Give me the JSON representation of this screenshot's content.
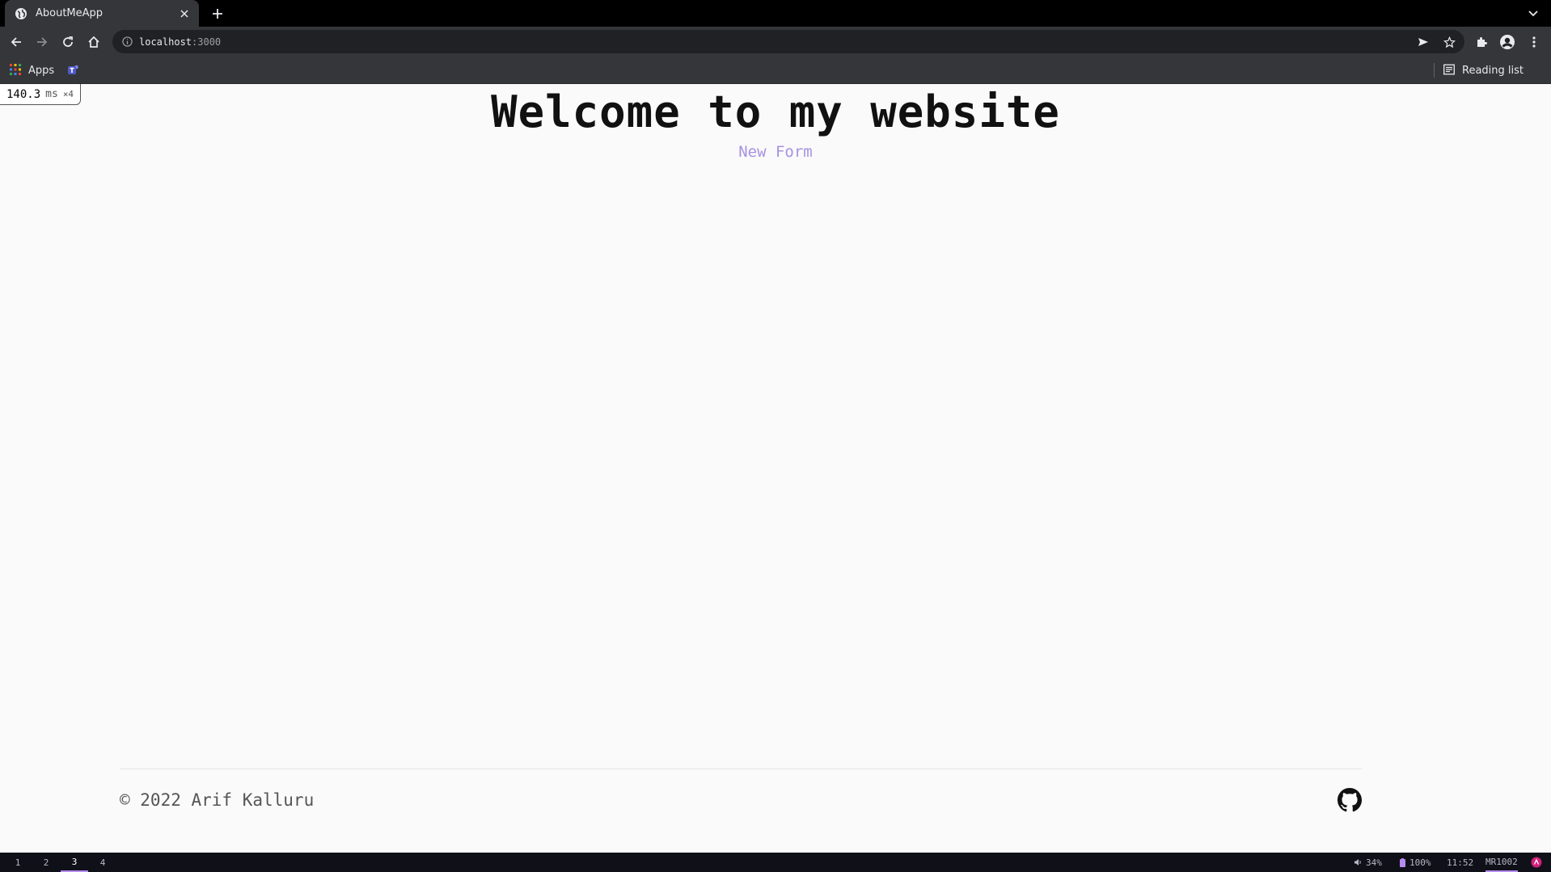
{
  "browser": {
    "tab_title": "AboutMeApp",
    "url_host": "localhost",
    "url_port": ":3000",
    "bookmarks": {
      "apps_label": "Apps",
      "reading_list_label": "Reading list"
    }
  },
  "perf": {
    "value": "140.3",
    "unit": "ms",
    "multiplier": "×4"
  },
  "page": {
    "headline": "Welcome to my website",
    "new_form_link": "New Form",
    "footer_copyright": "© 2022 Arif Kalluru"
  },
  "statusbar": {
    "workspaces": [
      "1",
      "2",
      "3",
      "4"
    ],
    "active_workspace": "3",
    "volume": "34%",
    "battery": "100%",
    "time": "11:52",
    "hostname": "MR1002"
  },
  "colors": {
    "link_accent": "#a593e0",
    "workspace_accent": "#b48cf0"
  }
}
